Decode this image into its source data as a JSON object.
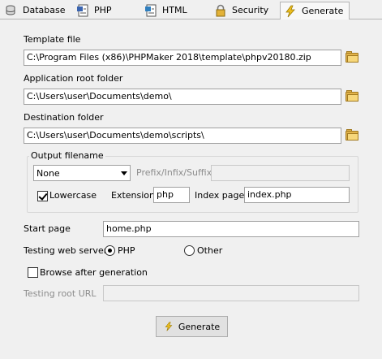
{
  "tabs": [
    {
      "label": "Database",
      "icon": "database-icon"
    },
    {
      "label": "PHP",
      "icon": "php-file-icon"
    },
    {
      "label": "HTML",
      "icon": "html-file-icon"
    },
    {
      "label": "Security",
      "icon": "lock-icon"
    },
    {
      "label": "Generate",
      "icon": "lightning-icon",
      "active": true
    }
  ],
  "template_file": {
    "label": "Template file",
    "value": "C:\\Program Files (x86)\\PHPMaker 2018\\template\\phpv20180.zip"
  },
  "app_root": {
    "label": "Application root folder",
    "value": "C:\\Users\\user\\Documents\\demo\\"
  },
  "destination": {
    "label": "Destination folder",
    "value": "C:\\Users\\user\\Documents\\demo\\scripts\\"
  },
  "output": {
    "title": "Output filename",
    "case_selected": "None",
    "prefix_label": "Prefix/Infix/Suffix",
    "prefix_value": "",
    "lowercase_label": "Lowercase",
    "lowercase_checked": true,
    "extension_label": "Extension",
    "extension_value": "php",
    "index_label": "Index page",
    "index_value": "index.php"
  },
  "start_page": {
    "label": "Start page",
    "value": "home.php"
  },
  "server": {
    "label": "Testing web server",
    "option_php": "PHP",
    "option_other": "Other",
    "selected": "PHP"
  },
  "browse": {
    "label": "Browse after generation",
    "checked": false
  },
  "testing_url": {
    "label": "Testing root URL",
    "value": ""
  },
  "generate_button": {
    "label": "Generate"
  },
  "colors": {
    "folder": "#e2b34a",
    "bolt": "#f0c020"
  }
}
